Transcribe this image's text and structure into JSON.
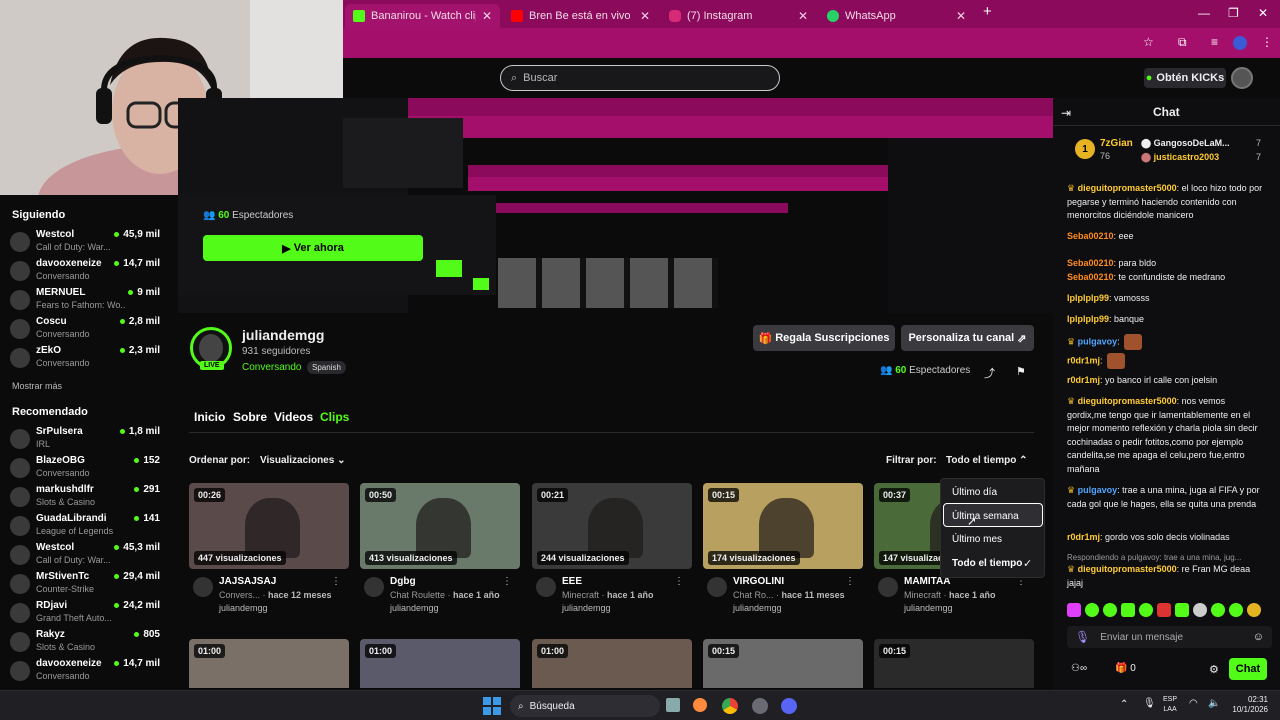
{
  "browser": {
    "tabs": [
      {
        "label": "Bananirou - Watch clips on Kick",
        "color": "#53fc18"
      },
      {
        "label": "Bren Be está en vivo - YouTube",
        "color": "#ff0000"
      },
      {
        "label": "(7) Instagram",
        "color": "#d62976"
      },
      {
        "label": "WhatsApp",
        "color": "#25d366"
      }
    ],
    "new_tab": "+",
    "win_min": "—",
    "win_max": "❐",
    "win_close": "✕"
  },
  "header": {
    "search_placeholder": "Buscar",
    "kicks_label": "Obtén KICKs"
  },
  "sidebar": {
    "following_title": "Siguiendo",
    "following": [
      {
        "name": "Westcol",
        "sub": "Call of Duty: War...",
        "viewers": "45,9 mil"
      },
      {
        "name": "davooxeneize",
        "sub": "Conversando",
        "viewers": "14,7 mil"
      },
      {
        "name": "MERNUEL",
        "sub": "Fears to Fathom: Wo...",
        "viewers": "9 mil"
      },
      {
        "name": "Coscu",
        "sub": "Conversando",
        "viewers": "2,8 mil"
      },
      {
        "name": "zEkO",
        "sub": "Conversando",
        "viewers": "2,3 mil"
      }
    ],
    "show_more": "Mostrar más",
    "recommended_title": "Recomendado",
    "recommended": [
      {
        "name": "SrPulsera",
        "sub": "IRL",
        "viewers": "1,8 mil"
      },
      {
        "name": "BlazeOBG",
        "sub": "Conversando",
        "viewers": "152"
      },
      {
        "name": "markushdlfr",
        "sub": "Slots & Casino",
        "viewers": "291"
      },
      {
        "name": "GuadaLibrandi",
        "sub": "League of Legends",
        "viewers": "141"
      },
      {
        "name": "Westcol",
        "sub": "Call of Duty: War...",
        "viewers": "45,3 mil"
      },
      {
        "name": "MrStivenTc",
        "sub": "Counter-Strike",
        "viewers": "29,4 mil"
      },
      {
        "name": "RDjavi",
        "sub": "Grand Theft Auto...",
        "viewers": "24,2 mil"
      },
      {
        "name": "Rakyz",
        "sub": "Slots & Casino",
        "viewers": "805"
      },
      {
        "name": "davooxeneize",
        "sub": "Conversando",
        "viewers": "14,7 mil"
      }
    ]
  },
  "overlay": {
    "viewers_count": "60",
    "viewers_label": "Espectadores",
    "watch_now": "Ver ahora"
  },
  "channel": {
    "name": "juliandemgg",
    "followers": "931 seguidores",
    "category": "Conversando",
    "language": "Spanish",
    "live_badge": "LIVE",
    "gift_subs": "Regala Suscripciones",
    "customize": "Personaliza tu canal",
    "viewers_count": "60",
    "viewers_label": "Espectadores"
  },
  "tabs": [
    "Inicio",
    "Sobre",
    "Videos",
    "Clips"
  ],
  "filters": {
    "sort_label": "Ordenar por:",
    "sort_value": "Visualizaciones",
    "filter_label": "Filtrar por:",
    "filter_value": "Todo el tiempo",
    "options": [
      "Último día",
      "Última semana",
      "Último mes",
      "Todo el tiempo"
    ],
    "selected_option": "Todo el tiempo",
    "hovered_option": "Última semana"
  },
  "clips": [
    {
      "duration": "00:26",
      "views": "447 visualizaciones",
      "title": "JAJSAJSAJ",
      "category": "Convers...",
      "age": "hace 12 meses",
      "author": "juliandemgg",
      "thumb": "#5a4a4a"
    },
    {
      "duration": "00:50",
      "views": "413 visualizaciones",
      "title": "Dgbg",
      "category": "Chat Roulette",
      "age": "hace 1 año",
      "author": "juliandemgg",
      "thumb": "#6a7a6a"
    },
    {
      "duration": "00:21",
      "views": "244 visualizaciones",
      "title": "EEE",
      "category": "Minecraft",
      "age": "hace 1 año",
      "author": "juliandemgg",
      "thumb": "#3a3a3a"
    },
    {
      "duration": "00:15",
      "views": "174 visualizaciones",
      "title": "VIRGOLINI",
      "category": "Chat Ro...",
      "age": "hace 11 meses",
      "author": "juliandemgg",
      "thumb": "#b8a060"
    },
    {
      "duration": "00:37",
      "views": "147 visualizaciones",
      "title": "MAMITAA",
      "category": "Minecraft",
      "age": "hace 1 año",
      "author": "juliandemgg",
      "thumb": "#4a6a3a"
    }
  ],
  "clips_row2": [
    {
      "duration": "01:00",
      "thumb": "#7a7068"
    },
    {
      "duration": "01:00",
      "thumb": "#5a5a6a"
    },
    {
      "duration": "01:00",
      "thumb": "#6a5a50"
    },
    {
      "duration": "00:15",
      "thumb": "#6a6a6a"
    },
    {
      "duration": "00:15",
      "thumb": "#2a2a2a"
    }
  ],
  "chat": {
    "title": "Chat",
    "top_gifters": [
      {
        "name": "7zGian",
        "count": "76"
      },
      {
        "name": "GangosoDeLaM...",
        "count": "7"
      },
      {
        "name": "justicastro2003",
        "count": "7"
      }
    ],
    "messages": [
      {
        "user": "dieguitopromaster5000",
        "text": ": el loco hizo todo por pegarse y terminó haciendo contenido con menorcitos diciéndole manicero",
        "color": "#ffcc33"
      },
      {
        "user": "Seba00210",
        "text": ": eee",
        "color": "#ff8c1a"
      },
      {
        "user": "Seba00210",
        "text": ": para bldo",
        "color": "#ff8c1a"
      },
      {
        "user": "Seba00210",
        "text": ": te confundiste de medrano",
        "color": "#ff8c1a"
      },
      {
        "user": "lplplplp99",
        "text": ": vamosss",
        "color": "#ffcc33"
      },
      {
        "user": "lplplplp99",
        "text": ": banque",
        "color": "#ffcc33"
      },
      {
        "user": "pulgavoy",
        "text": ":",
        "color": "#4da6ff"
      },
      {
        "user": "r0dr1mj",
        "text": ":",
        "color": "#ffcc33"
      },
      {
        "user": "r0dr1mj",
        "text": ": yo banco irl calle con joelsin",
        "color": "#ffcc33"
      },
      {
        "user": "dieguitopromaster5000",
        "text": ": nos vemos gordix,me tengo que ir lamentablemente en el mejor momento reflexión y charla piola sin decir cochinadas o pedir fotitos,como por ejemplo candelita,se me apaga el celu,pero fue,entro mañana",
        "color": "#ffcc33"
      },
      {
        "user": "pulgavoy",
        "text": ": trae a una mina, juga al FIFA y por cada gol que le hages, ella se quita una prenda",
        "color": "#4da6ff"
      },
      {
        "user": "r0dr1mj",
        "text": ": gordo vos solo decis violinadas",
        "color": "#ffcc33"
      },
      {
        "user": "dieguitopromaster5000",
        "text": ": re Fran MG deaa jajaj",
        "color": "#ffcc33"
      }
    ],
    "reply_note": "Respondiendo a pulgavoy: trae a una mina, jug...",
    "input_placeholder": "Enviar un mensaje",
    "kicks_count": "0",
    "send_label": "Chat"
  },
  "taskbar": {
    "search_label": "Búsqueda",
    "lang_top": "ESP",
    "lang_bottom": "LAA",
    "time": "02:31",
    "date": "10/1/2026"
  }
}
